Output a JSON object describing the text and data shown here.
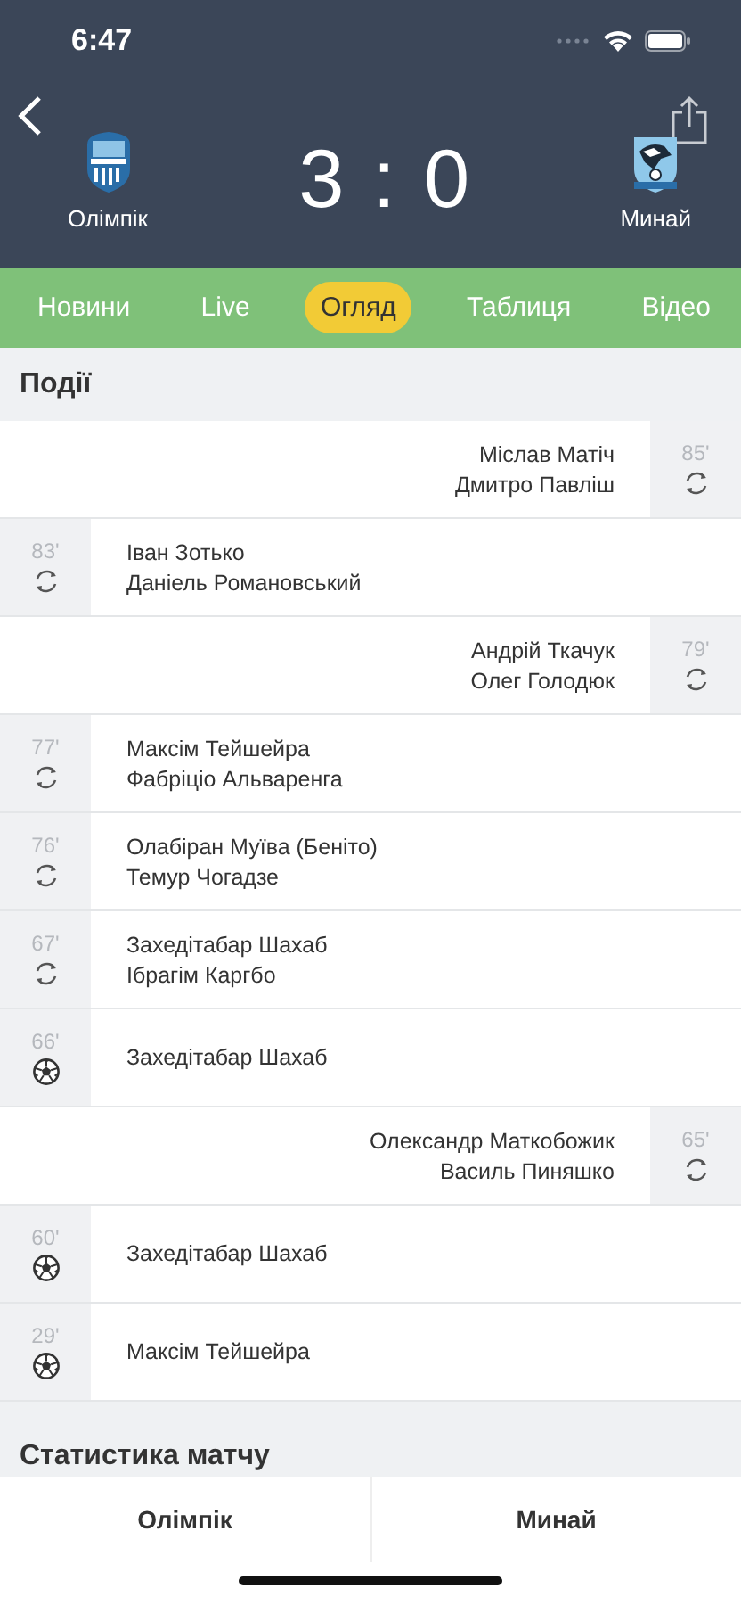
{
  "status_bar": {
    "time": "6:47"
  },
  "match": {
    "home": {
      "name": "Олімпік"
    },
    "away": {
      "name": "Минай"
    },
    "score_home": "3",
    "separator": ":",
    "score_away": "0"
  },
  "tabs": [
    {
      "label": "Новини",
      "selected": false
    },
    {
      "label": "Live",
      "selected": false
    },
    {
      "label": "Огляд",
      "selected": true
    },
    {
      "label": "Таблиця",
      "selected": false
    },
    {
      "label": "Відео",
      "selected": false
    }
  ],
  "events_section": {
    "title": "Події"
  },
  "events": [
    {
      "away_team": true,
      "minute": "85'",
      "kind": "sub",
      "players": [
        "Міслав Матіч",
        "Дмитро Павліш"
      ]
    },
    {
      "away_team": false,
      "minute": "83'",
      "kind": "sub",
      "players": [
        "Іван Зотько",
        "Даніель Романовський"
      ]
    },
    {
      "away_team": true,
      "minute": "79'",
      "kind": "sub",
      "players": [
        "Андрій Ткачук",
        "Олег Голодюк"
      ]
    },
    {
      "away_team": false,
      "minute": "77'",
      "kind": "sub",
      "players": [
        "Максім Тейшейра",
        "Фабріціо Альваренга"
      ]
    },
    {
      "away_team": false,
      "minute": "76'",
      "kind": "sub",
      "players": [
        "Олабіран Муїва (Беніто)",
        "Темур Чогадзе"
      ]
    },
    {
      "away_team": false,
      "minute": "67'",
      "kind": "sub",
      "players": [
        "Захедітабар Шахаб",
        "Ібрагім Каргбо"
      ]
    },
    {
      "away_team": false,
      "minute": "66'",
      "kind": "goal",
      "players": [
        "Захедітабар Шахаб"
      ]
    },
    {
      "away_team": true,
      "minute": "65'",
      "kind": "sub",
      "players": [
        "Олександр Маткобожик",
        "Василь Пиняшко"
      ]
    },
    {
      "away_team": false,
      "minute": "60'",
      "kind": "goal",
      "players": [
        "Захедітабар Шахаб"
      ]
    },
    {
      "away_team": false,
      "minute": "29'",
      "kind": "goal",
      "players": [
        "Максім Тейшейра"
      ]
    }
  ],
  "stats_section": {
    "title": "Статистика матчу"
  },
  "bottom_tabs": [
    {
      "label": "Олімпік"
    },
    {
      "label": "Минай"
    }
  ]
}
